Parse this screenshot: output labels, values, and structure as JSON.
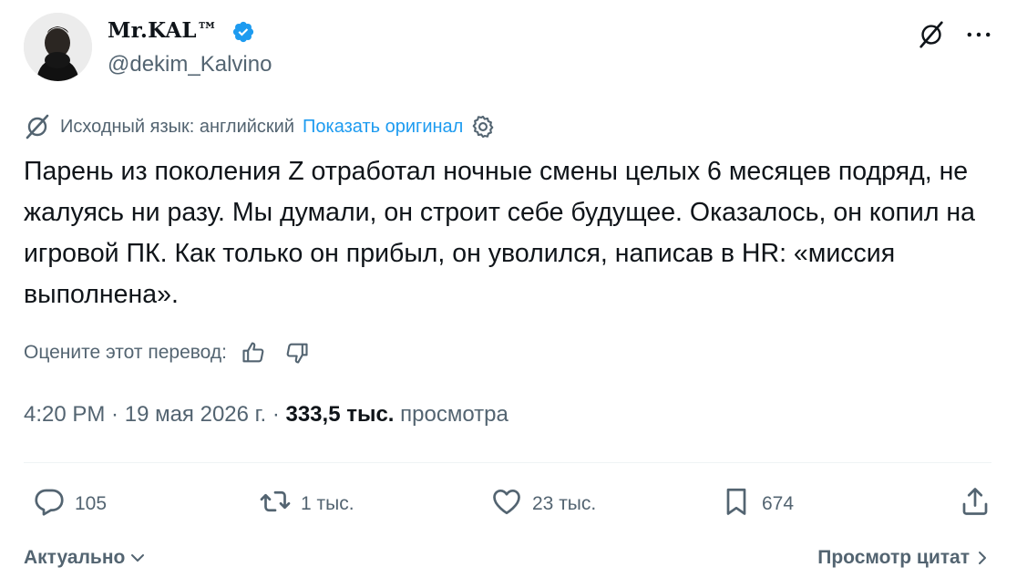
{
  "author": {
    "display_name": "Mr.KAL™",
    "handle": "@dekim_Kalvino",
    "verified": true
  },
  "icons": {
    "avatar": "profile-photo",
    "verified": "verified-badge-icon",
    "grok": "grok-icon",
    "more": "more-dots-icon",
    "translate": "translate-icon",
    "settings": "gear-icon",
    "like_thumb": "thumbs-up-icon",
    "dislike_thumb": "thumbs-down-icon",
    "reply": "reply-bubble-icon",
    "retweet": "retweet-icon",
    "like": "heart-icon",
    "bookmark": "bookmark-icon",
    "share": "share-icon",
    "chevron": "chevron-icon"
  },
  "colors": {
    "text": "#0f1419",
    "secondary": "#536471",
    "accent": "#1d9bf0",
    "divider": "#eff3f4"
  },
  "translation": {
    "source_label": "Исходный язык: английский",
    "show_original": "Показать оригинал"
  },
  "tweet": {
    "text": "Парень из поколения Z отработал ночные смены целых 6 месяцев подряд, не жалуясь ни разу. Мы думали, он строит себе будущее. Оказалось, он копил на игровой ПК. Как только он прибыл, он уволился, написав в HR: «миссия выполнена»."
  },
  "rate": {
    "label": "Оцените этот перевод:"
  },
  "meta": {
    "time": "4:20 PM",
    "sep1": " · ",
    "date": "19 мая 2026 г.",
    "sep2": " · ",
    "views_count": "333,5 тыс.",
    "views_label": "просмотра"
  },
  "actions": {
    "replies": "105",
    "retweets": "1 тыс.",
    "likes": "23 тыс.",
    "bookmarks": "674"
  },
  "footer": {
    "sort_label": "Актуально",
    "quotes_label": "Просмотр цитат"
  }
}
